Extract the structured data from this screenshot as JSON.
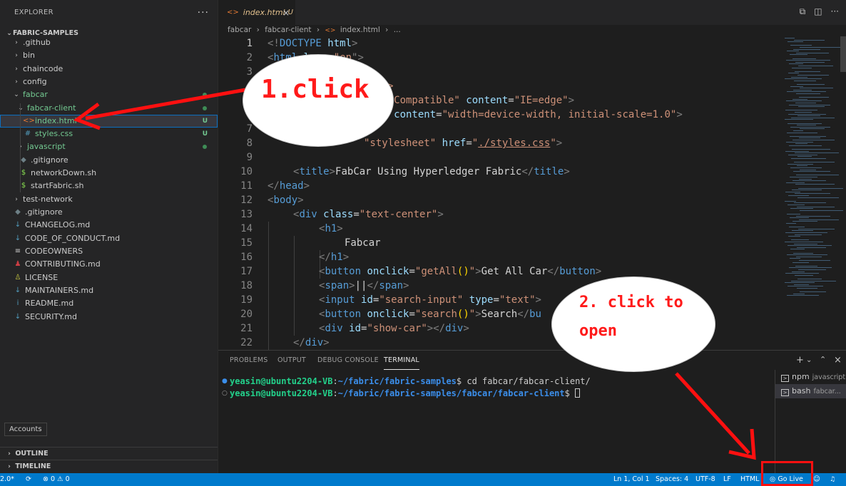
{
  "sidebar": {
    "title": "EXPLORER",
    "more": "···",
    "root": "FABRIC-SAMPLES",
    "items": [
      {
        "label": ".github",
        "chevron": "›",
        "icon": ""
      },
      {
        "label": "bin",
        "chevron": "›",
        "icon": ""
      },
      {
        "label": "chaincode",
        "chevron": "›",
        "icon": ""
      },
      {
        "label": "config",
        "chevron": "›",
        "icon": ""
      },
      {
        "label": "fabcar",
        "chevron": "⌄",
        "icon": ""
      },
      {
        "label": "fabcar-client",
        "chevron": "⌄",
        "icon": ""
      },
      {
        "label": "index.html",
        "icon": "<>",
        "decoration": "U"
      },
      {
        "label": "styles.css",
        "icon": "#",
        "decoration": "U"
      },
      {
        "label": "javascript",
        "chevron": "›",
        "icon": ""
      },
      {
        "label": ".gitignore",
        "icon": "◆"
      },
      {
        "label": "networkDown.sh",
        "icon": "$"
      },
      {
        "label": "startFabric.sh",
        "icon": "$"
      },
      {
        "label": "test-network",
        "chevron": "›",
        "icon": ""
      },
      {
        "label": ".gitignore",
        "icon": "◆"
      },
      {
        "label": "CHANGELOG.md",
        "icon": "↓"
      },
      {
        "label": "CODE_OF_CONDUCT.md",
        "icon": "↓"
      },
      {
        "label": "CODEOWNERS",
        "icon": "≡"
      },
      {
        "label": "CONTRIBUTING.md",
        "icon": "♟"
      },
      {
        "label": "LICENSE",
        "icon": "♙"
      },
      {
        "label": "MAINTAINERS.md",
        "icon": "↓"
      },
      {
        "label": "README.md",
        "icon": "i"
      },
      {
        "label": "SECURITY.md",
        "icon": "↓"
      }
    ],
    "outline": "OUTLINE",
    "timeline": "TIMELINE",
    "accounts_tooltip": "Accounts"
  },
  "editor": {
    "tab": {
      "label": "index.html",
      "status": "U",
      "close": "×"
    },
    "breadcrumb": [
      "fabcar",
      "fabcar-client",
      "index.html",
      "..."
    ],
    "lines": [
      {
        "n": "1"
      },
      {
        "n": "2"
      },
      {
        "n": "3"
      },
      {
        "n": "4"
      },
      {
        "n": "5"
      },
      {
        "n": "6"
      },
      {
        "n": "7"
      },
      {
        "n": "8"
      },
      {
        "n": "9"
      },
      {
        "n": "10"
      },
      {
        "n": "11"
      },
      {
        "n": "12"
      },
      {
        "n": "13"
      },
      {
        "n": "14"
      },
      {
        "n": "15"
      },
      {
        "n": "16"
      },
      {
        "n": "17"
      },
      {
        "n": "18"
      },
      {
        "n": "19"
      },
      {
        "n": "20"
      },
      {
        "n": "21"
      },
      {
        "n": "22"
      }
    ],
    "code": {
      "l1": [
        "<!",
        "DOCTYPE",
        " html",
        ">"
      ],
      "l2": [
        "<",
        "html",
        " la",
        "ng=\"",
        "en",
        "\">"
      ],
      "l4": [
        "TF-8\">"
      ],
      "l5": [
        "X-UA-Compatible\"",
        " content",
        "=",
        "\"IE=edge\"",
        ">"
      ],
      "l6": [
        "ort\"",
        " content",
        "=",
        "\"width=device-width, initial-scale=1.0\"",
        ">"
      ],
      "l8": [
        "\"stylesheet\"",
        " href",
        "=",
        "\"",
        "./styles.css",
        "\"",
        ">"
      ],
      "l10": [
        "<",
        "title",
        ">",
        "FabCar Using Hyperledger Fabric",
        "</",
        "title",
        ">"
      ],
      "l11": [
        "</",
        "head",
        ">"
      ],
      "l12": [
        "<",
        "body",
        ">"
      ],
      "l13": [
        "<",
        "div",
        " class",
        "=",
        "\"text-center\"",
        ">"
      ],
      "l14": [
        "<",
        "h1",
        ">"
      ],
      "l15": [
        "Fabcar"
      ],
      "l16": [
        "</",
        "h1",
        ">"
      ],
      "l17": [
        "<",
        "button",
        " onclick",
        "=",
        "\"getAll",
        "()",
        "\"",
        ">",
        "Get All Car",
        "</",
        "button",
        ">"
      ],
      "l18": [
        "<",
        "span",
        ">",
        "||",
        "</",
        "span",
        ">"
      ],
      "l19": [
        "<",
        "input",
        " id",
        "=",
        "\"search-input\"",
        " type",
        "=",
        "\"text\"",
        ">"
      ],
      "l20": [
        "<",
        "button",
        " onclick",
        "=",
        "\"search",
        "()",
        "\"",
        ">",
        "Search",
        "</",
        "bu"
      ],
      "l21": [
        "<",
        "div",
        " id",
        "=",
        "\"show-car\"",
        "></",
        "div",
        ">"
      ],
      "l22": [
        "</",
        "div",
        ">"
      ]
    }
  },
  "panel": {
    "tabs": [
      "PROBLEMS",
      "OUTPUT",
      "DEBUG CONSOLE",
      "TERMINAL"
    ],
    "actions": [
      "+",
      "⌄",
      "⌃",
      "×"
    ],
    "terminal_lines": [
      {
        "user": "yeasin@ubuntu2204-VB",
        "sep": ":",
        "path": "~/fabric/fabric-samples",
        "prompt": "$ ",
        "cmd": "cd fabcar/fabcar-client/"
      },
      {
        "user": "yeasin@ubuntu2204-VB",
        "sep": ":",
        "path": "~/fabric/fabric-samples/fabcar/fabcar-client",
        "prompt": "$ ",
        "cmd": ""
      }
    ],
    "terminal_list": [
      {
        "name": "npm",
        "sub": "javascript"
      },
      {
        "name": "bash",
        "sub": "fabcar..."
      }
    ]
  },
  "statusbar": {
    "left_version": "2.0*",
    "sync": "⟳",
    "errors": "⊗ 0 ⚠ 0",
    "position": "Ln 1, Col 1",
    "spaces": "Spaces: 4",
    "encoding": "UTF-8",
    "eol": "LF",
    "language": "HTML",
    "go_live": "Go Live",
    "bell": "🔔"
  },
  "annotations": {
    "step1": "1.click",
    "step2_line1": "2. click to",
    "step2_line2": "open"
  }
}
